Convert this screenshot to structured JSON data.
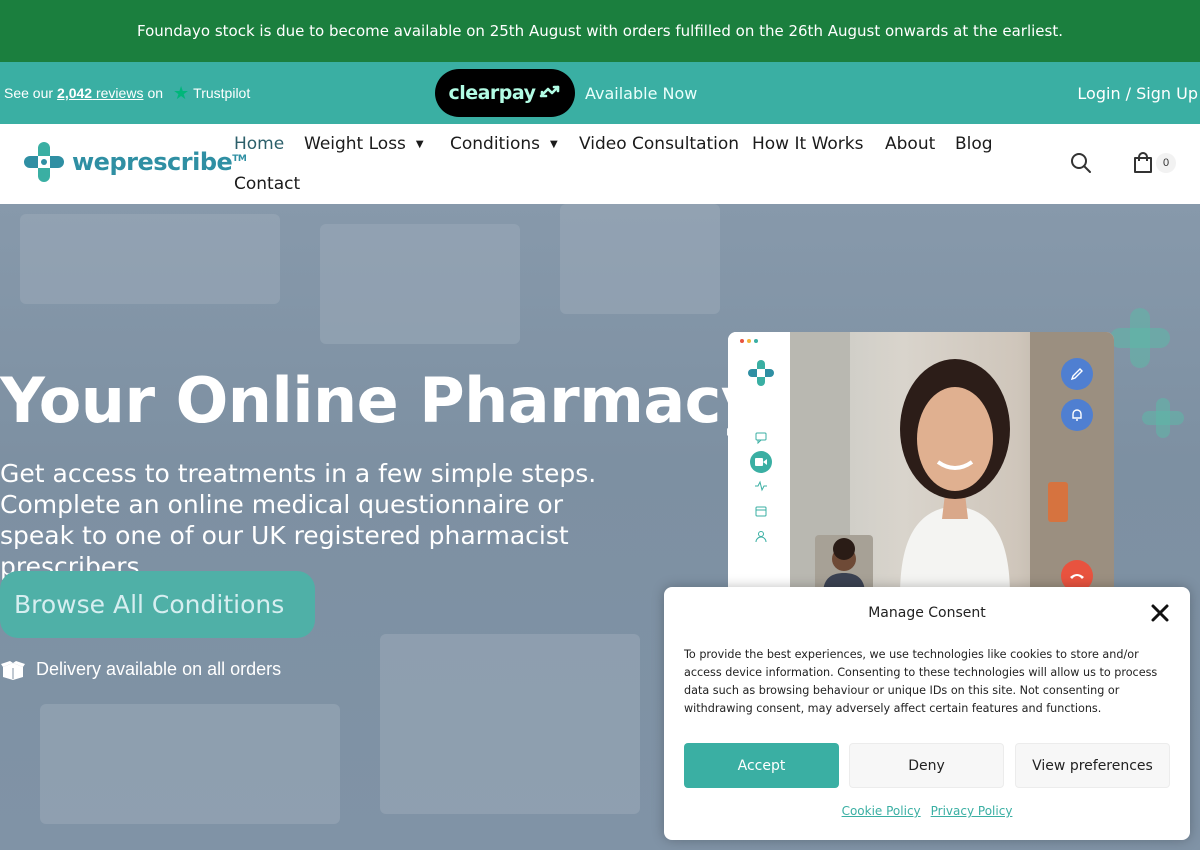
{
  "announcement": "Foundayo stock is due to become available on 25th August with orders fulfilled on the 26th August onwards at the earliest.",
  "topbar": {
    "reviews_prefix": "See our",
    "reviews_count": "2,042",
    "reviews_word": "reviews",
    "reviews_suffix": "on",
    "trustpilot": "Trustpilot",
    "clearpay": "clearpay",
    "available": "Available Now",
    "login": "Login / Sign Up"
  },
  "header": {
    "logo_text": "weprescribe",
    "logo_tm": "TM",
    "nav": [
      "Home",
      "Weight Loss",
      "Conditions",
      "Video Consultation",
      "How It Works",
      "About",
      "Blog",
      "Contact"
    ],
    "cart_count": "0"
  },
  "hero": {
    "title": "Your Online Pharmacy",
    "subtitle": "Get access to treatments in a few simple steps. Complete an online medical questionnaire or speak to one of our UK registered pharmacist prescribers.",
    "cta": "Browse All Conditions",
    "delivery": "Delivery available on all orders"
  },
  "consent": {
    "title": "Manage Consent",
    "body": "To provide the best experiences, we use technologies like cookies to store and/or access device information. Consenting to these technologies will allow us to process data such as browsing behaviour or unique IDs on this site. Not consenting or withdrawing consent, may adversely affect certain features and functions.",
    "accept": "Accept",
    "deny": "Deny",
    "preferences": "View preferences",
    "cookie_policy": "Cookie Policy",
    "privacy_policy": "Privacy Policy"
  },
  "colors": {
    "announcement_bg": "#1b7f3e",
    "brand_teal": "#3aafa3",
    "clearpay_mint": "#b2fce4",
    "end_call_red": "#e8533f"
  }
}
